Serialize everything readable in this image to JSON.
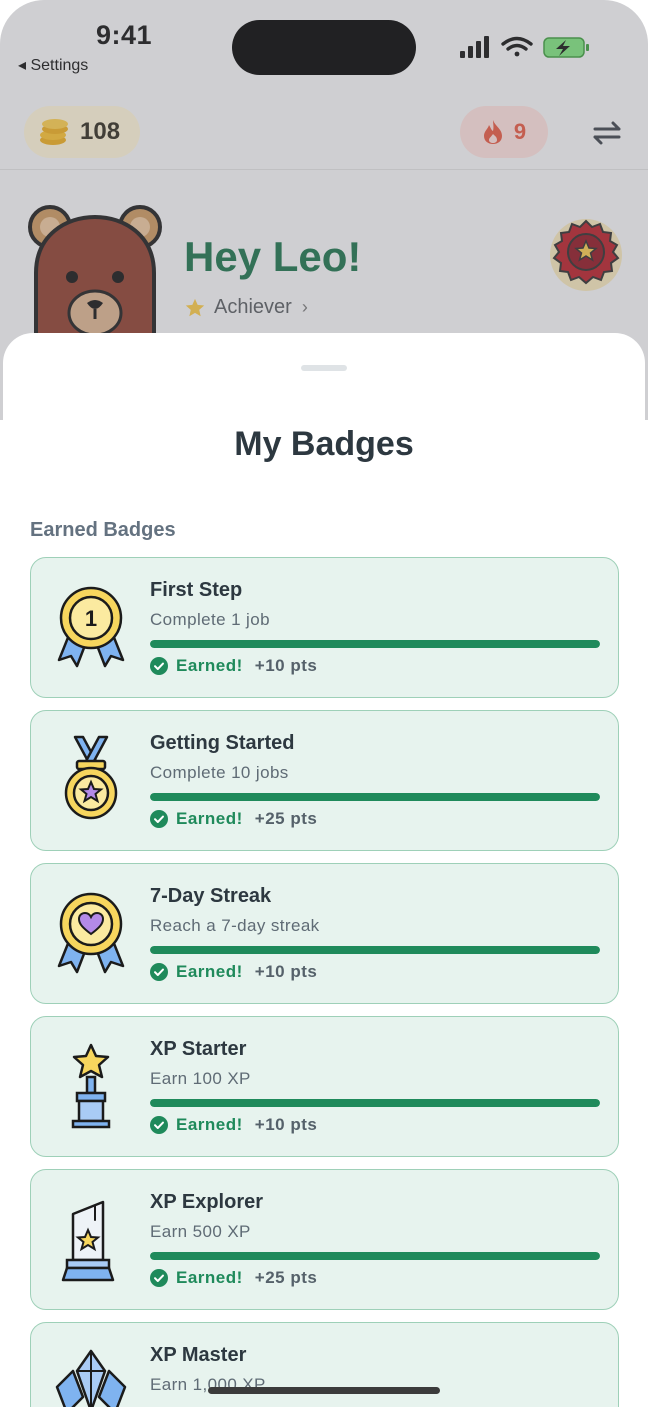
{
  "status_bar": {
    "time": "9:41",
    "back_label": "Settings"
  },
  "header": {
    "coins": "108",
    "streak": "9"
  },
  "profile": {
    "greeting": "Hey Leo!",
    "rank": "Achiever"
  },
  "sheet": {
    "title": "My Badges",
    "section_label": "Earned Badges",
    "badges": [
      {
        "name": "First Step",
        "description": "Complete 1 job",
        "status": "Earned!",
        "points": "+10 pts",
        "icon": "medal-ribbon-1-icon",
        "progress": 1.0
      },
      {
        "name": "Getting Started",
        "description": "Complete 10 jobs",
        "status": "Earned!",
        "points": "+25 pts",
        "icon": "medal-star-icon",
        "progress": 1.0
      },
      {
        "name": "7-Day Streak",
        "description": "Reach a 7-day streak",
        "status": "Earned!",
        "points": "+10 pts",
        "icon": "medal-heart-icon",
        "progress": 1.0
      },
      {
        "name": "XP Starter",
        "description": "Earn 100 XP",
        "status": "Earned!",
        "points": "+10 pts",
        "icon": "star-trophy-icon",
        "progress": 1.0
      },
      {
        "name": "XP Explorer",
        "description": "Earn 500 XP",
        "status": "Earned!",
        "points": "+25 pts",
        "icon": "crystal-award-icon",
        "progress": 1.0
      },
      {
        "name": "XP Master",
        "description": "Earn 1,000 XP",
        "icon": "crystal-gem-icon"
      }
    ]
  },
  "colors": {
    "accent": "#1f8a5b",
    "card_bg": "#e7f3ee",
    "card_border": "#9ed0b8",
    "greeting": "#197049"
  }
}
